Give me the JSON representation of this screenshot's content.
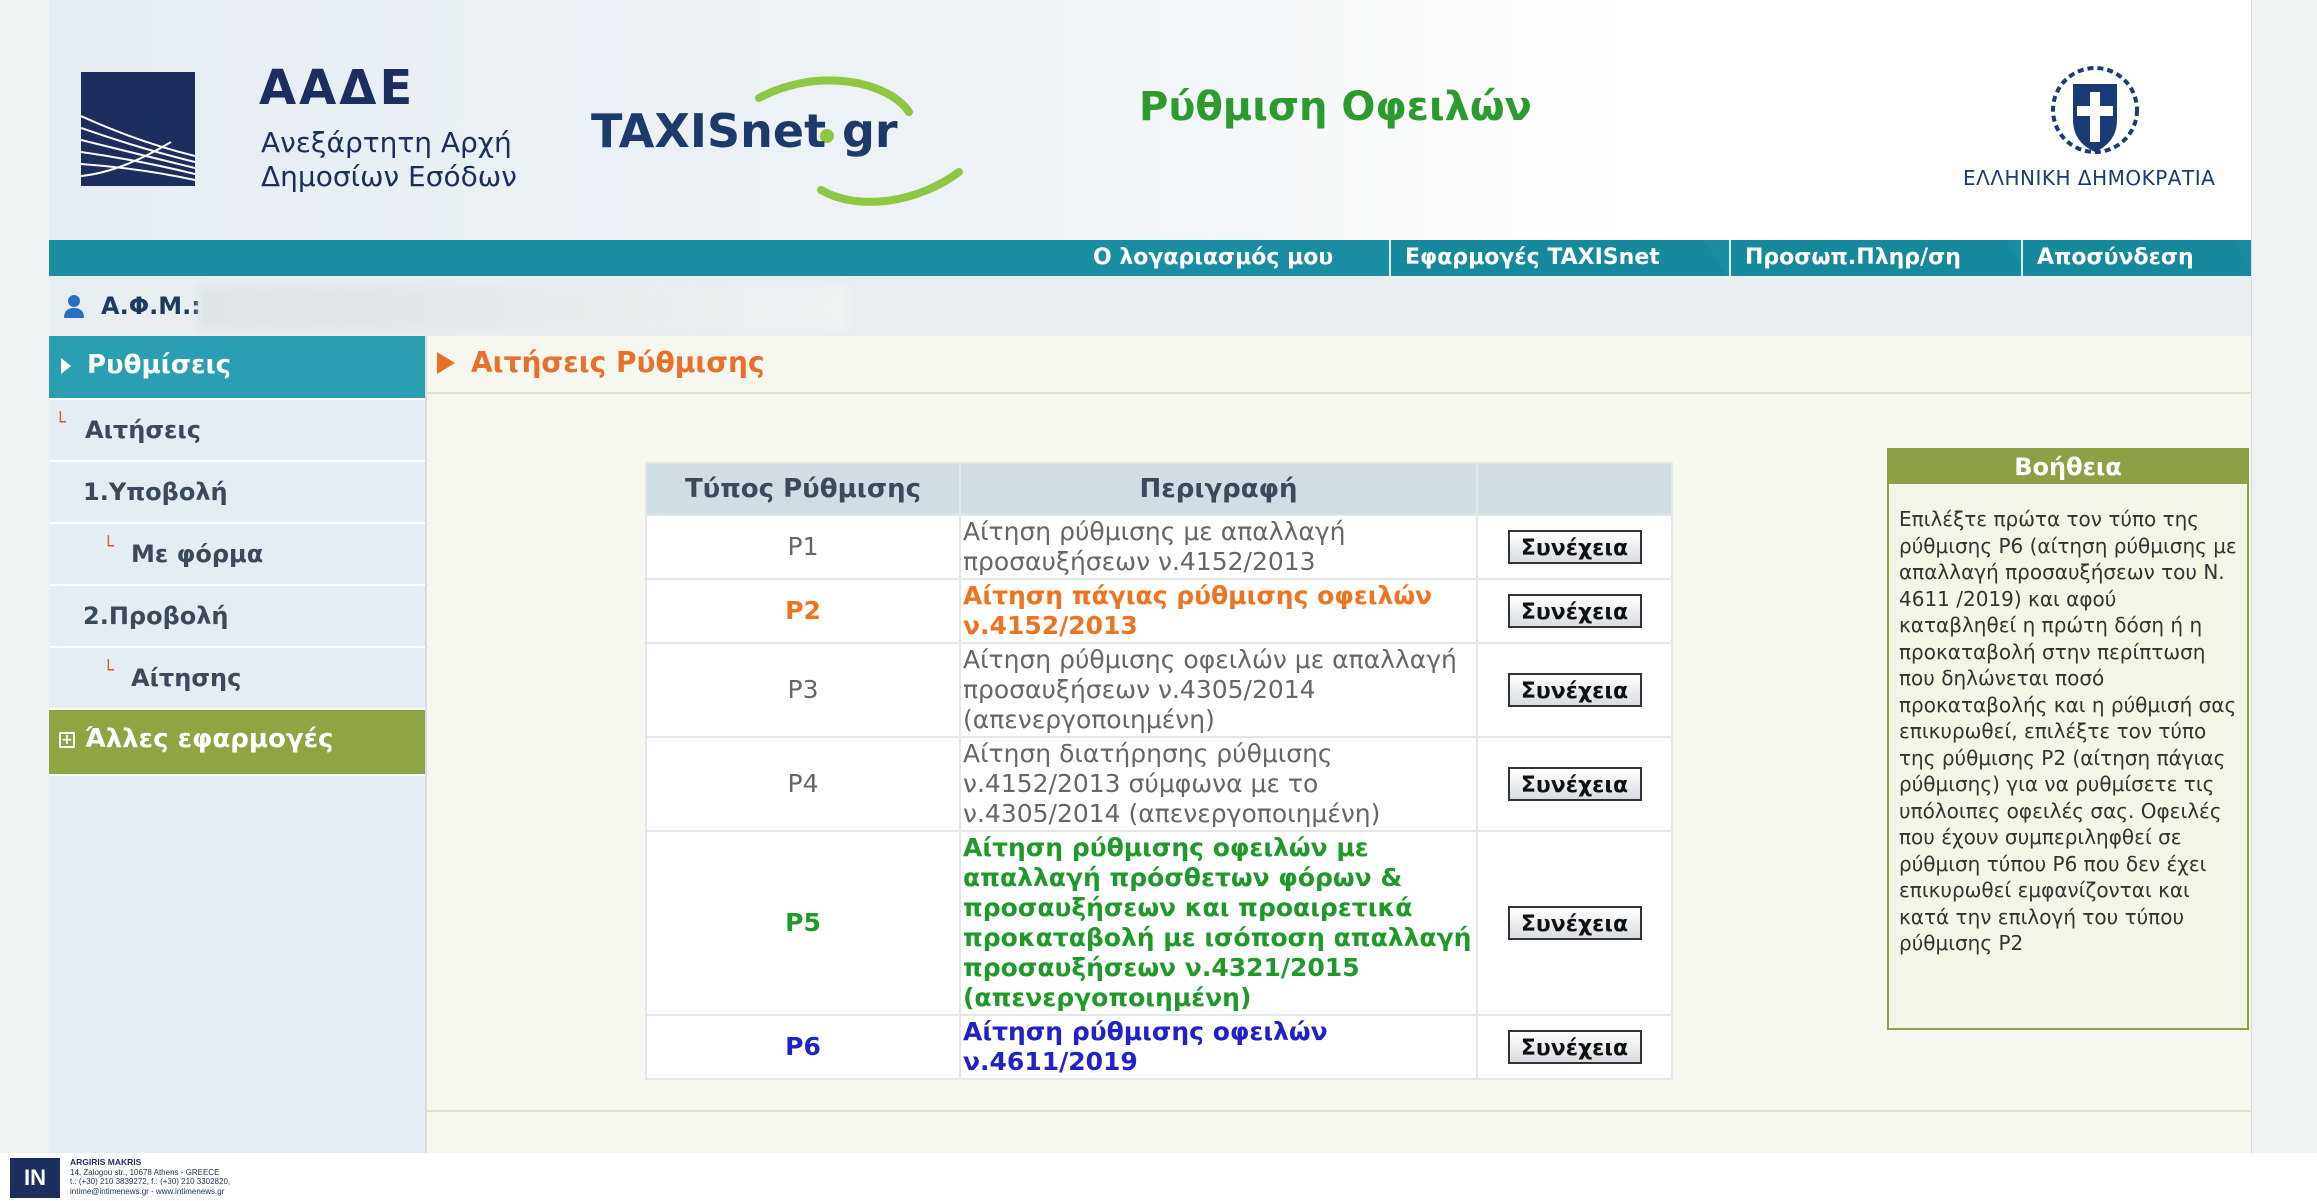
{
  "header": {
    "org_short": "ΑΑΔΕ",
    "org_line1": "Ανεξάρτητη Αρχή",
    "org_line2": "Δημοσίων Εσόδων",
    "brand_main": "TAXISnet",
    "brand_gr": "gr",
    "page_heading": "Ρύθμιση Οφειλών",
    "state_label": "ΕΛΛΗΝΙΚΗ ΔΗΜΟΚΡΑΤΙΑ"
  },
  "nav": {
    "account": "Ο λογαριασμός μου",
    "apps": "Εφαρμογές TAXISnet",
    "personal": "Προσωπ.Πληρ/ση",
    "logout": "Αποσύνδεση"
  },
  "user": {
    "afm_label": "Α.Φ.Μ.:"
  },
  "sidebar": {
    "settlements": "Ρυθμίσεις",
    "applications": "Αιτήσεις",
    "submit": "1.Υποβολή",
    "with_form": "Με φόρμα",
    "view": "2.Προβολή",
    "application": "Αίτησης",
    "other_apps": "Άλλες εφαρμογές"
  },
  "content": {
    "section_title": "Αιτήσεις Ρύθμισης",
    "table": {
      "col_type": "Τύπος Ρύθμισης",
      "col_desc": "Περιγραφή",
      "col_action": "",
      "rows": [
        {
          "type": "P1",
          "desc": "Αίτηση ρύθμισης με απαλλαγή προσαυξήσεων ν.4152/2013",
          "action": "Συνέχεια"
        },
        {
          "type": "P2",
          "desc": "Αίτηση πάγιας ρύθμισης οφειλών ν.4152/2013",
          "action": "Συνέχεια"
        },
        {
          "type": "P3",
          "desc": "Αίτηση ρύθμισης οφειλών με απαλλαγή προσαυξήσεων ν.4305/2014 (απενεργοποιημένη)",
          "action": "Συνέχεια"
        },
        {
          "type": "P4",
          "desc": "Αίτηση διατήρησης ρύθμισης ν.4152/2013 σύμφωνα με το ν.4305/2014 (απενεργοποιημένη)",
          "action": "Συνέχεια"
        },
        {
          "type": "P5",
          "desc": "Αίτηση ρύθμισης οφειλών με απαλλαγή πρόσθετων φόρων & προσαυξήσεων και προαιρετικά προκαταβολή με ισόποση απαλλαγή προσαυξήσεων ν.4321/2015 (απενεργοποιημένη)",
          "action": "Συνέχεια"
        },
        {
          "type": "P6",
          "desc": "Αίτηση ρύθμισης οφειλών ν.4611/2019",
          "action": "Συνέχεια"
        }
      ]
    }
  },
  "help": {
    "title": "Βοήθεια",
    "text": "Επιλέξτε πρώτα τον τύπο της ρύθμισης P6 (αίτηση ρύθμισης με απαλλαγή προσαυξήσεων του Ν. 4611 /2019) και αφού καταβληθεί η πρώτη δόση ή η προκαταβολή στην περίπτωση που δηλώνεται ποσό προκαταβολής και η ρύθμισή σας επικυρωθεί, επιλέξτε τον τύπο της ρύθμισης P2 (αίτηση πάγιας ρύθμισης) για να ρυθμίσετε τις υπόλοιπες οφειλές σας. Οφειλές που έχουν συμπεριληφθεί σε ρύθμιση τύπου P6 που δεν έχει επικυρωθεί εμφανίζονται και κατά την επιλογή του τύπου ρύθμισης P2"
  },
  "footer": {
    "badge": "IN",
    "credit_name": "ARGIRIS MAKRIS",
    "credit_addr": "14, Zalogou str., 10678 Athens - GREECE",
    "credit_tel": "t.: (+30) 210 3839272, f.: (+30) 210 3302820,",
    "credit_web": "intime@intimenews.gr - www.intimenews.gr"
  },
  "colors": {
    "teal": "#1a8da2",
    "orange": "#f07420",
    "green": "#1f9a2a",
    "blue": "#1e22c8",
    "olive": "#8ea046",
    "navy": "#1c2e5e"
  }
}
